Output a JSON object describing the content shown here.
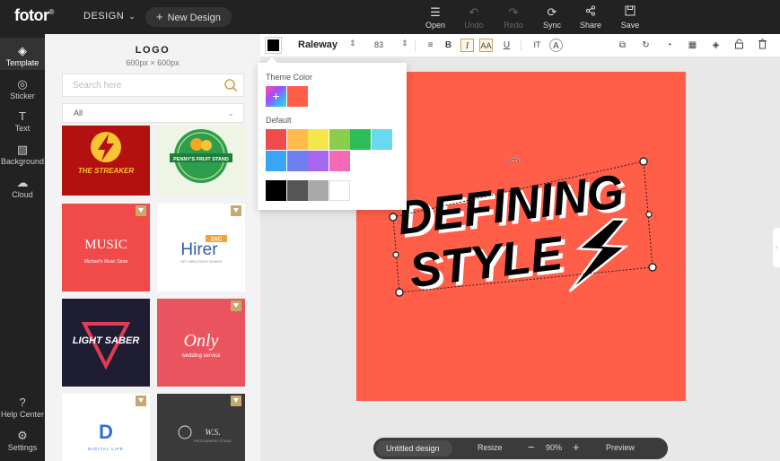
{
  "app": {
    "logo_text": "fotor",
    "logo_mark": "®",
    "design_menu_label": "DESIGN",
    "new_design_label": "New Design"
  },
  "toolbar": {
    "open": "Open",
    "undo": "Undo",
    "redo": "Redo",
    "sync": "Sync",
    "share": "Share",
    "save": "Save"
  },
  "rail": {
    "template": "Template",
    "sticker": "Sticker",
    "text": "Text",
    "background": "Background",
    "cloud": "Cloud",
    "help": "Help Center",
    "settings": "Settings"
  },
  "panel": {
    "title": "LOGO",
    "subtitle": "600px × 600px",
    "search_placeholder": "Search here",
    "filter_value": "All",
    "templates": [
      {
        "title": "THE STREAKER",
        "bg": "#b31010"
      },
      {
        "title": "PENNY'S FRUIT STAND",
        "bg": "#eef5e4"
      },
      {
        "title": "Michael's Music Store",
        "bg": "#f14a4a",
        "art": "MUSIC"
      },
      {
        "title": "Hirer",
        "sub": "GET HIRED RIGHT NOWER",
        "tag": "ZAC",
        "bg": "#ffffff"
      },
      {
        "title": "LIGHT SABER",
        "bg": "#1f1d33"
      },
      {
        "title": "Only",
        "sub": "wedding service",
        "bg": "#e9545e"
      },
      {
        "title": "DIGITAL LIFE",
        "bg": "#ffffff",
        "art": "D"
      },
      {
        "title": "W.S.",
        "sub": "PHOTOGRAPHY STUDIO",
        "bg": "#3a3a3a"
      }
    ]
  },
  "format": {
    "font_name": "Raleway",
    "font_size": "83",
    "color": "#000000"
  },
  "color_popup": {
    "theme_label": "Theme Color",
    "default_label": "Default",
    "theme_colors": [
      "#ff5e48"
    ],
    "default_colors": [
      "#ef4b4b",
      "#ffbb4d",
      "#f5e64c",
      "#8ccd4e",
      "#2ebd59",
      "#6ad9ef",
      "#3aa4f5",
      "#6f7ff0",
      "#a567ee",
      "#f56ab7",
      "#000000",
      "#555555",
      "#a9a9a9",
      "#ffffff"
    ]
  },
  "canvas": {
    "background": "#ff5e48",
    "line1": "DEFINING",
    "line2": "STYLE"
  },
  "bottom": {
    "doc_name": "Untitled design",
    "resize": "Resize",
    "zoom_out": "−",
    "zoom": "90%",
    "zoom_in": "+",
    "preview": "Preview"
  }
}
